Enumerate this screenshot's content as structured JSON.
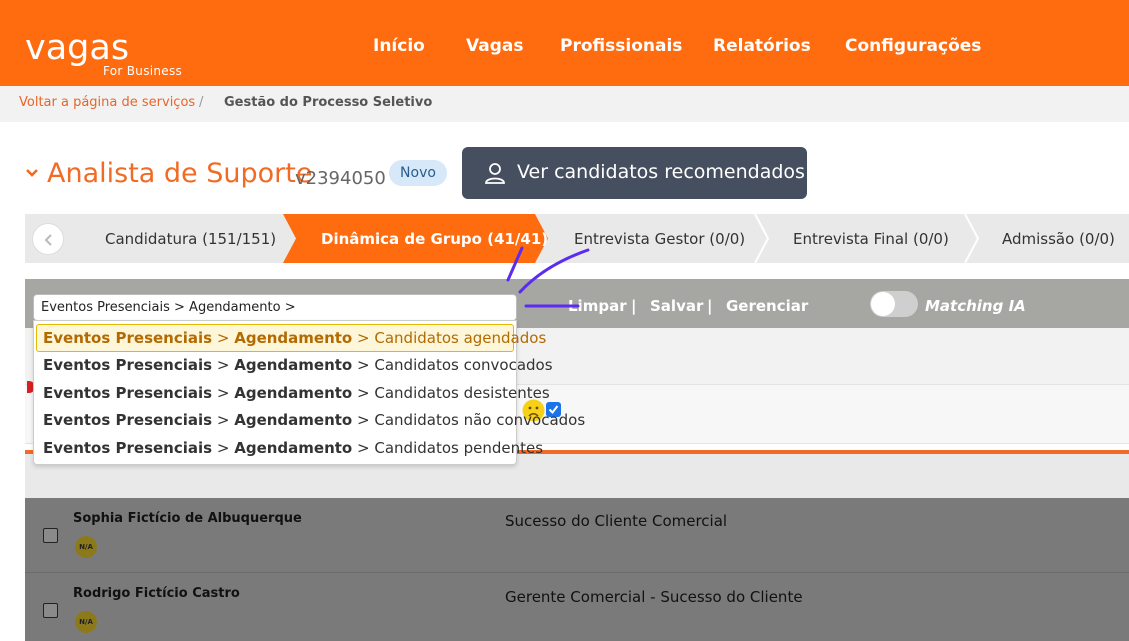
{
  "header": {
    "logo_main": "vagas",
    "logo_sub": "For Business",
    "nav": [
      "Início",
      "Vagas",
      "Profissionais",
      "Relatórios",
      "Configurações"
    ],
    "brand_color": "#ff6b0f"
  },
  "breadcrumb": {
    "back_link": "Voltar a página de serviços",
    "separator": "/",
    "current": "Gestão do Processo Seletivo"
  },
  "job": {
    "title": "Analista de Suporte",
    "code": "v2394050",
    "badge": "Novo",
    "recommend_button": "Ver candidatos recomendados"
  },
  "stages": [
    {
      "label": "Candidatura (151/151)",
      "active": false
    },
    {
      "label": "Dinâmica de Grupo (41/41)",
      "active": true
    },
    {
      "label": "Entrevista Gestor (0/0)",
      "active": false
    },
    {
      "label": "Entrevista Final (0/0)",
      "active": false
    },
    {
      "label": "Admissão (0/0)",
      "active": false
    }
  ],
  "filter": {
    "input_value": "Eventos Presenciais > Agendamento >",
    "actions": [
      "Limpar",
      "Salvar",
      "Gerenciar"
    ],
    "action_sep": "|",
    "matching_label": "Matching IA",
    "matching_on": false
  },
  "dropdown": {
    "prefix_1": "Eventos Presenciais",
    "arrow": ">",
    "prefix_2": "Agendamento",
    "options": [
      "Candidatos agendados",
      "Candidatos convocados",
      "Candidatos desistentes",
      "Candidatos não convocados",
      "Candidatos pendentes"
    ],
    "highlighted_index": 0
  },
  "candidates": [
    {
      "name": "Sophia Fictício de Albuquerque",
      "badge": "N/A",
      "position": "Sucesso do Cliente Comercial"
    },
    {
      "name": "Rodrigo Fictício Castro",
      "badge": "N/A",
      "position": "Gerente Comercial - Sucesso do Cliente"
    }
  ]
}
